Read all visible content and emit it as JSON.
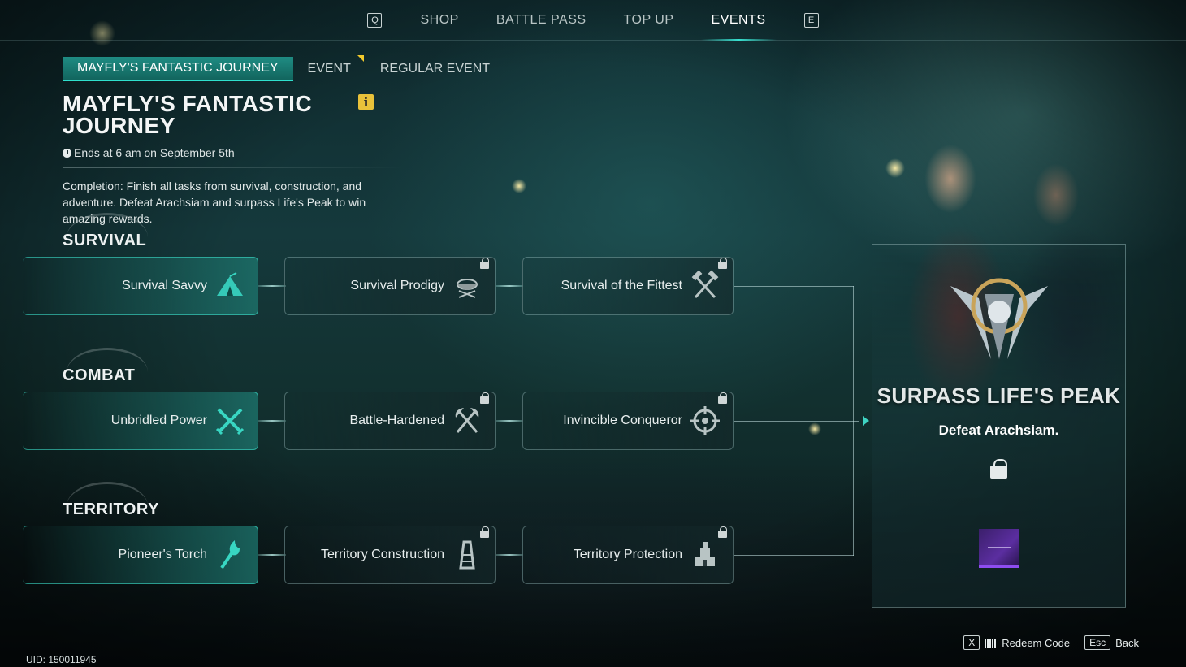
{
  "topnav": {
    "left_key": "Q",
    "right_key": "E",
    "tabs": [
      {
        "label": "SHOP"
      },
      {
        "label": "BATTLE PASS"
      },
      {
        "label": "TOP UP"
      },
      {
        "label": "EVENTS",
        "active": true
      }
    ]
  },
  "subtabs": [
    {
      "label": "MAYFLY'S FANTASTIC JOURNEY",
      "active": true
    },
    {
      "label": "EVENT",
      "flag": true
    },
    {
      "label": "REGULAR EVENT"
    }
  ],
  "event": {
    "title": "MAYFLY'S FANTASTIC JOURNEY",
    "ends": "Ends at 6 am on September 5th",
    "description": "Completion: Finish all tasks from survival, construction, and adventure. Defeat Arachsiam and surpass Life's Peak to win amazing rewards."
  },
  "sections": {
    "survival": {
      "label": "SURVIVAL",
      "tasks": [
        {
          "label": "Survival Savvy",
          "icon": "tent-icon",
          "locked": false
        },
        {
          "label": "Survival Prodigy",
          "icon": "campfire-pot-icon",
          "locked": true
        },
        {
          "label": "Survival of the Fittest",
          "icon": "crossed-hammers-icon",
          "locked": true
        }
      ]
    },
    "combat": {
      "label": "COMBAT",
      "tasks": [
        {
          "label": "Unbridled Power",
          "icon": "crossed-swords-icon",
          "locked": false
        },
        {
          "label": "Battle-Hardened",
          "icon": "crossed-axes-icon",
          "locked": true
        },
        {
          "label": "Invincible Conqueror",
          "icon": "crosshair-icon",
          "locked": true
        }
      ]
    },
    "territory": {
      "label": "TERRITORY",
      "tasks": [
        {
          "label": "Pioneer's Torch",
          "icon": "torch-icon",
          "locked": false
        },
        {
          "label": "Territory Construction",
          "icon": "tower-icon",
          "locked": true
        },
        {
          "label": "Territory Protection",
          "icon": "fortress-icon",
          "locked": true
        }
      ]
    }
  },
  "reward": {
    "title": "SURPASS LIFE'S PEAK",
    "subtitle": "Defeat Arachsiam.",
    "locked": true
  },
  "footer": {
    "uid": "UID: 150011945",
    "redeem_key": "X",
    "redeem_label": "Redeem Code",
    "back_key": "Esc",
    "back_label": "Back"
  },
  "colors": {
    "accent": "#2fe0cd",
    "flag": "#f2c92c",
    "info": "#e9c23a",
    "reward_item": "#5b2ea0"
  }
}
